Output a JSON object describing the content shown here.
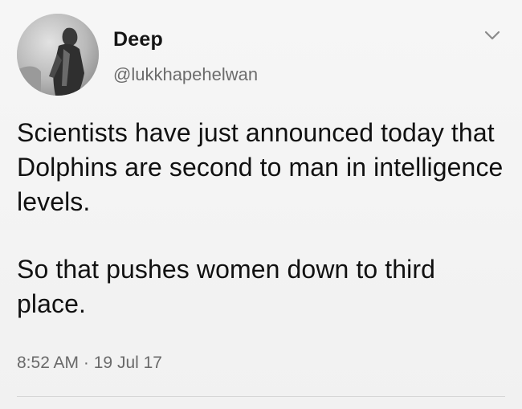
{
  "user": {
    "display_name": "Deep",
    "handle": "@lukkhapehelwan",
    "avatar_icon": "user-avatar"
  },
  "menu": {
    "icon": "chevron-down-icon"
  },
  "tweet": {
    "paragraphs": [
      "Scientists have just announced today that Dolphins are second to man in intelligence levels.",
      "So that pushes women down to third place."
    ],
    "time": "8:52 AM",
    "separator": "·",
    "date": "19 Jul 17"
  }
}
